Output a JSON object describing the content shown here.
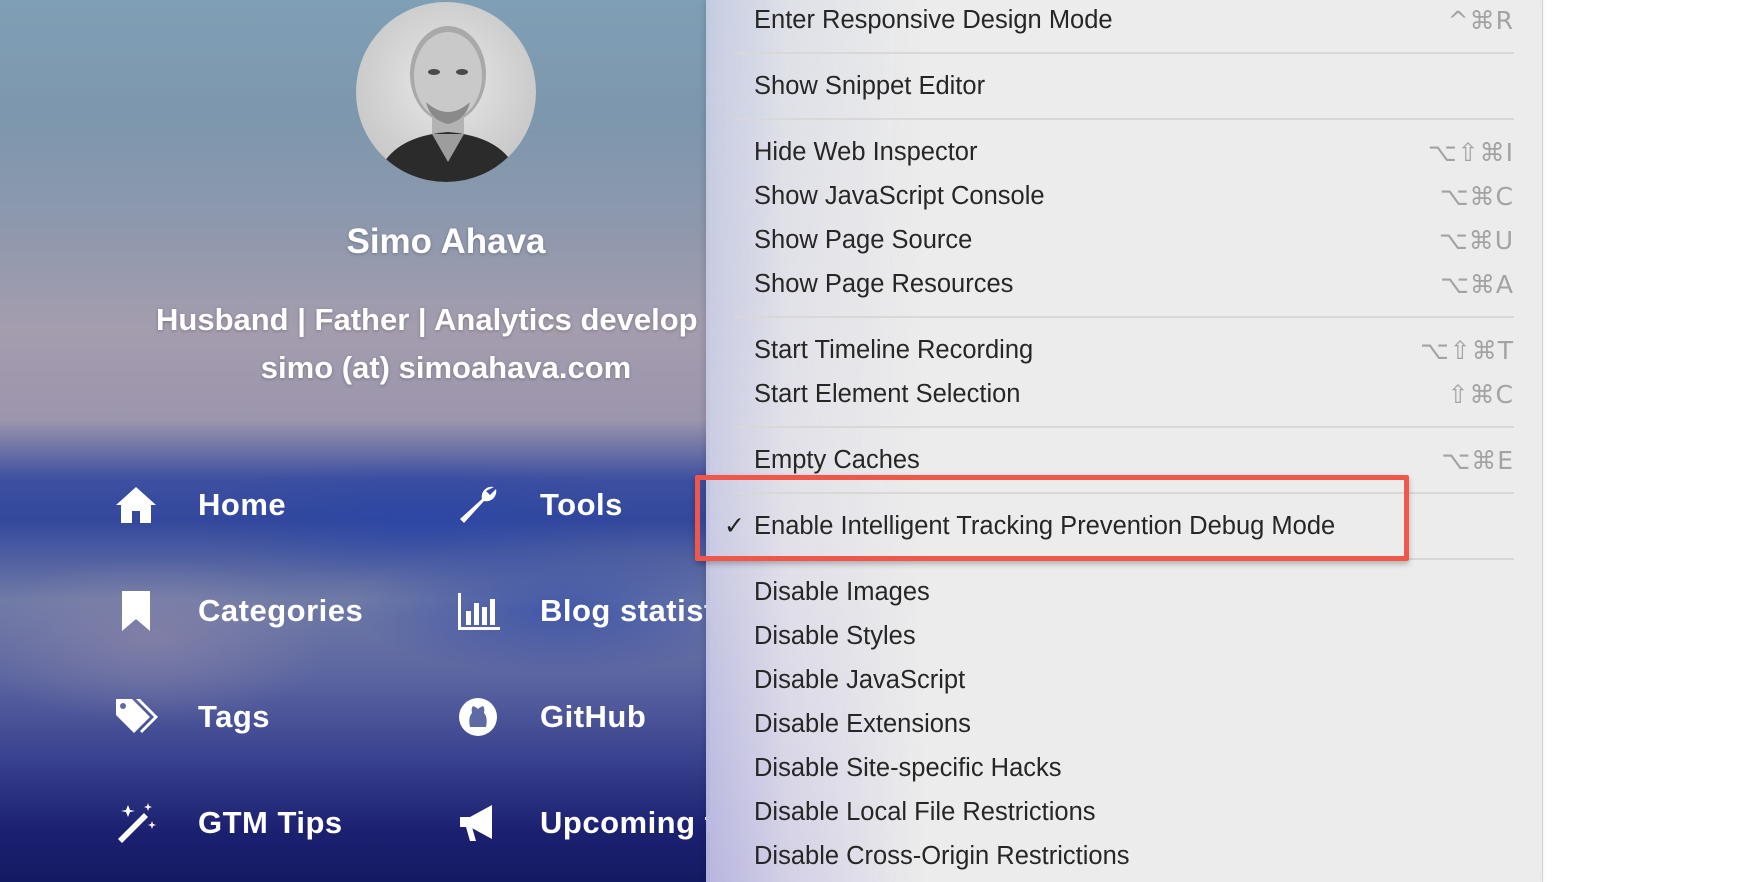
{
  "site": {
    "name": "Simo Ahava",
    "tagline": "Husband | Father | Analytics develop",
    "email": "simo (at) simoahava.com",
    "nav": [
      {
        "label": "Home",
        "icon": "home-icon"
      },
      {
        "label": "Tools",
        "icon": "wrench-icon"
      },
      {
        "label": "Categories",
        "icon": "bookmark-icon"
      },
      {
        "label": "Blog statist",
        "icon": "bar-chart-icon"
      },
      {
        "label": "Tags",
        "icon": "tags-icon"
      },
      {
        "label": "GitHub",
        "icon": "github-icon"
      },
      {
        "label": "GTM Tips",
        "icon": "magic-wand-icon"
      },
      {
        "label": "Upcoming t",
        "icon": "bullhorn-icon"
      }
    ]
  },
  "menu": {
    "items": [
      {
        "label": "Enter Responsive Design Mode",
        "shortcut": "^⌘R"
      },
      {
        "label": "Show Snippet Editor",
        "shortcut": ""
      },
      {
        "label": "Hide Web Inspector",
        "shortcut": "⌥⇧⌘I"
      },
      {
        "label": "Show JavaScript Console",
        "shortcut": "⌥⌘C"
      },
      {
        "label": "Show Page Source",
        "shortcut": "⌥⌘U"
      },
      {
        "label": "Show Page Resources",
        "shortcut": "⌥⌘A"
      },
      {
        "label": "Start Timeline Recording",
        "shortcut": "⌥⇧⌘T"
      },
      {
        "label": "Start Element Selection",
        "shortcut": "⇧⌘C"
      },
      {
        "label": "Empty Caches",
        "shortcut": "⌥⌘E"
      },
      {
        "label": "Enable Intelligent Tracking Prevention Debug Mode",
        "shortcut": "",
        "checked": true,
        "check_mark": "✓"
      },
      {
        "label": "Disable Images",
        "shortcut": ""
      },
      {
        "label": "Disable Styles",
        "shortcut": ""
      },
      {
        "label": "Disable JavaScript",
        "shortcut": ""
      },
      {
        "label": "Disable Extensions",
        "shortcut": ""
      },
      {
        "label": "Disable Site-specific Hacks",
        "shortcut": ""
      },
      {
        "label": "Disable Local File Restrictions",
        "shortcut": ""
      },
      {
        "label": "Disable Cross-Origin Restrictions",
        "shortcut": ""
      }
    ]
  },
  "colors": {
    "highlight_border": "#f0574a",
    "menu_background": "#ececec",
    "shortcut_text": "#a3a3a3"
  }
}
